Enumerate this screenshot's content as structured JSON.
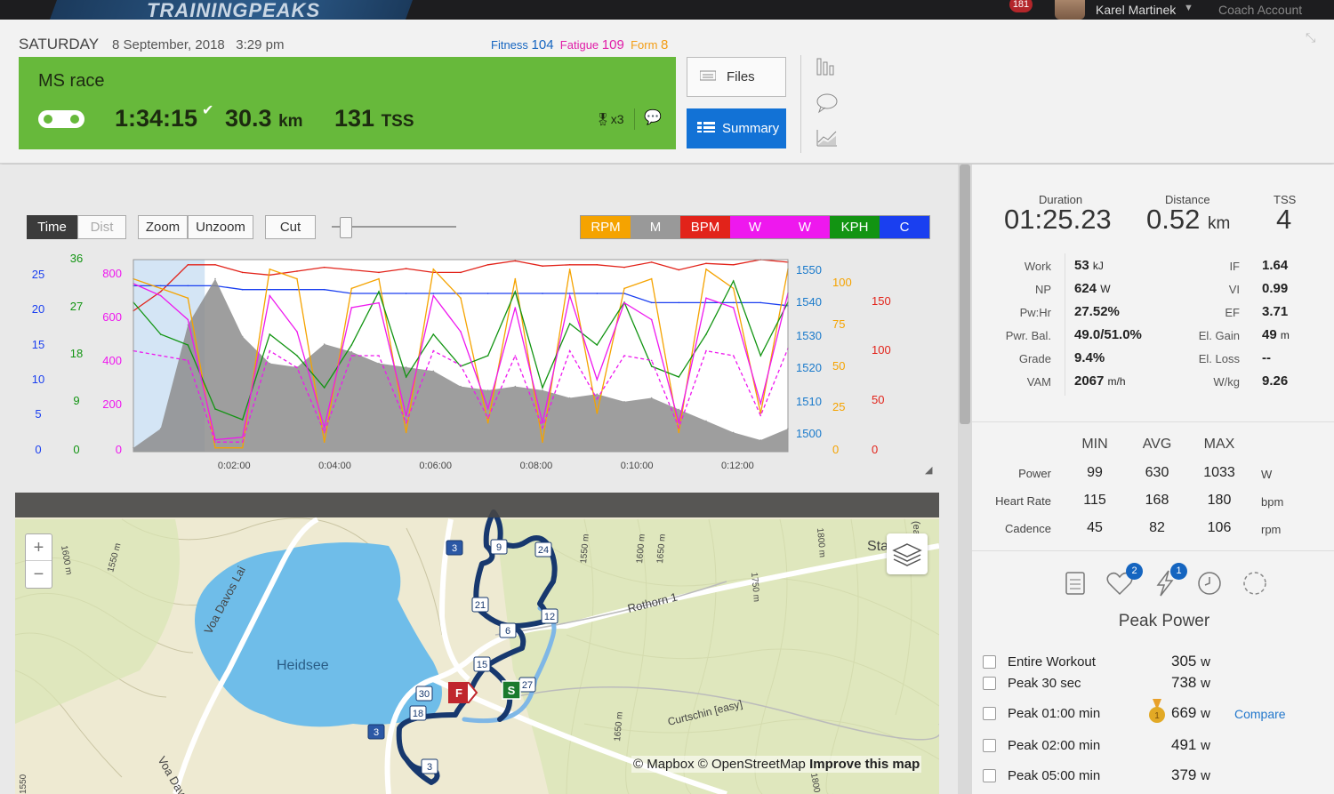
{
  "app": {
    "logo": "TRAININGPEAKS",
    "notifications": "181",
    "user": "Karel Martinek",
    "coach": "Coach Account"
  },
  "header": {
    "day": "SATURDAY",
    "datetime": "8 September, 2018   3:29 pm",
    "fitness_label": "Fitness",
    "fitness": "104",
    "fatigue_label": "Fatigue",
    "fatigue": "109",
    "form_label": "Form",
    "form": "8",
    "fitness_color": "#1565c0",
    "fatigue_color": "#e01ea8",
    "form_color": "#f39c12"
  },
  "workout": {
    "name": "MS race",
    "duration": "1:34:15",
    "distance": "30.3",
    "distance_unit": "km",
    "tss": "131",
    "tss_unit": "TSS",
    "medals": "x3",
    "color": "#67b93b"
  },
  "buttons": {
    "files": "Files",
    "summary": "Summary"
  },
  "toolbar": {
    "time": "Time",
    "dist": "Dist",
    "zoom": "Zoom",
    "unzoom": "Unzoom",
    "cut": "Cut"
  },
  "legend": [
    {
      "label": "RPM",
      "color": "#f5a300"
    },
    {
      "label": "M",
      "color": "#999999"
    },
    {
      "label": "BPM",
      "color": "#e2231a"
    },
    {
      "label": "W",
      "color": "#ee18ee"
    },
    {
      "label": "W",
      "color": "#ee18ee"
    },
    {
      "label": "KPH",
      "color": "#129412"
    },
    {
      "label": "C",
      "color": "#1a3ff0"
    }
  ],
  "chart_data": {
    "type": "line",
    "x_ticks": [
      "0:02:00",
      "0:04:00",
      "0:06:00",
      "0:08:00",
      "0:10:00",
      "0:12:00"
    ],
    "axes": {
      "blue_ticks": [
        "25",
        "20",
        "15",
        "10",
        "5",
        "0"
      ],
      "green_ticks": [
        "36",
        "27",
        "18",
        "9",
        "0"
      ],
      "magenta_ticks": [
        "800",
        "600",
        "400",
        "200",
        "0"
      ],
      "elev_ticks": [
        "1550",
        "1540",
        "1530",
        "1520",
        "1510",
        "1500"
      ],
      "orange_ticks": [
        "100",
        "75",
        "50",
        "25",
        "0"
      ],
      "red_ticks": [
        "150",
        "100",
        "50",
        "0"
      ]
    },
    "ylim": {
      "blue": [
        0,
        25
      ],
      "green": [
        0,
        36
      ],
      "magenta": [
        0,
        800
      ],
      "elevation": [
        1500,
        1550
      ],
      "orange": [
        0,
        100
      ],
      "red": [
        0,
        150
      ]
    },
    "series": [
      {
        "name": "BPM",
        "color": "#e2231a",
        "axis": "red",
        "values": [
          110,
          125,
          146,
          146,
          140,
          138,
          141,
          144,
          142,
          140,
          143,
          140,
          140,
          146,
          149,
          145,
          146,
          146,
          144,
          148,
          142,
          147,
          146,
          150,
          148
        ]
      },
      {
        "name": "C",
        "color": "#1a3ff0",
        "axis": "blue",
        "values": [
          21.6,
          21.6,
          21.6,
          21.6,
          21.1,
          21.1,
          21.1,
          21.1,
          20.6,
          20.6,
          20.6,
          20.6,
          20.6,
          20.6,
          20.6,
          20.6,
          20.6,
          20.6,
          20.6,
          19.4,
          19.4,
          19.4,
          19.4,
          19.4,
          19.0
        ]
      },
      {
        "name": "M",
        "color": "#999999",
        "axis": "elev",
        "values": [
          1501,
          1506,
          1533,
          1545,
          1530,
          1523,
          1522,
          1528,
          1526,
          1523,
          1522,
          1521,
          1517,
          1516,
          1517,
          1516,
          1514,
          1515,
          1513,
          1514,
          1511,
          1508,
          1505,
          1503,
          1506
        ]
      },
      {
        "name": "RPM",
        "color": "#f5a300",
        "axis": "orange",
        "values": [
          90,
          85,
          80,
          2,
          2,
          95,
          90,
          5,
          85,
          90,
          10,
          95,
          80,
          15,
          90,
          5,
          95,
          20,
          85,
          90,
          10,
          95,
          85,
          20,
          95
        ]
      },
      {
        "name": "KPH",
        "color": "#129412",
        "axis": "green",
        "values": [
          28,
          22,
          20,
          8,
          6,
          22,
          18,
          12,
          20,
          30,
          14,
          22,
          16,
          18,
          30,
          12,
          24,
          20,
          28,
          16,
          14,
          22,
          32,
          18,
          28
        ]
      },
      {
        "name": "W",
        "color": "#ee18ee",
        "axis": "magenta",
        "values": [
          700,
          650,
          550,
          50,
          60,
          650,
          500,
          100,
          600,
          620,
          150,
          650,
          500,
          180,
          600,
          120,
          650,
          300,
          620,
          550,
          120,
          640,
          600,
          200,
          660
        ]
      },
      {
        "name": "W",
        "color": "#ee18ee",
        "axis": "magenta",
        "values": [
          420,
          400,
          380,
          40,
          40,
          420,
          350,
          80,
          400,
          400,
          120,
          420,
          360,
          140,
          400,
          100,
          420,
          220,
          400,
          380,
          100,
          420,
          400,
          150,
          430
        ]
      }
    ],
    "selection": {
      "from": "0:00:00",
      "to": "0:01:25"
    }
  },
  "map": {
    "labels": {
      "lake": "Heidsee",
      "road1": "Voa Davos Lai",
      "road2": "Rothorn 1",
      "road3": "Curtschin [easy]",
      "road4": "Voa Davos",
      "road5": "Sta",
      "road6": "(easy)",
      "c1": "1600 m",
      "c2": "1550 m",
      "c3": "1550 m",
      "c4": "1600 m",
      "c5": "1650 m",
      "c6": "1750 m",
      "c7": "1800 m",
      "c8": "1650 m",
      "c9": "1550",
      "c10": "1800 m"
    },
    "markers": [
      "3",
      "9",
      "24",
      "21",
      "12",
      "6",
      "15",
      "27",
      "30",
      "18",
      "3",
      "3"
    ],
    "start": "S",
    "finish": "F",
    "zoom_in": "+",
    "zoom_out": "−",
    "attribution_mapbox": "© Mapbox",
    "attribution_osm": "© OpenStreetMap",
    "improve": "Improve this map"
  },
  "summary": {
    "duration_label": "Duration",
    "duration": "01:25.23",
    "distance_label": "Distance",
    "distance": "0.52",
    "distance_unit": "km",
    "tss_label": "TSS",
    "tss": "4",
    "left_stats": [
      {
        "label": "Work",
        "value": "53",
        "unit": "kJ"
      },
      {
        "label": "NP",
        "value": "624",
        "unit": "W"
      },
      {
        "label": "Pw:Hr",
        "value": "27.52%",
        "unit": ""
      },
      {
        "label": "Pwr. Bal.",
        "value": "49.0/51.0%",
        "unit": ""
      },
      {
        "label": "Grade",
        "value": "9.4%",
        "unit": ""
      },
      {
        "label": "VAM",
        "value": "2067",
        "unit": "m/h"
      }
    ],
    "right_stats": [
      {
        "label": "IF",
        "value": "1.64",
        "unit": ""
      },
      {
        "label": "VI",
        "value": "0.99",
        "unit": ""
      },
      {
        "label": "EF",
        "value": "3.71",
        "unit": ""
      },
      {
        "label": "El. Gain",
        "value": "49",
        "unit": "m"
      },
      {
        "label": "El. Loss",
        "value": "--",
        "unit": ""
      },
      {
        "label": "W/kg",
        "value": "9.26",
        "unit": ""
      }
    ],
    "mma_headers": [
      "MIN",
      "AVG",
      "MAX"
    ],
    "mma_rows": [
      {
        "label": "Power",
        "min": "99",
        "avg": "630",
        "max": "1033",
        "unit": "W"
      },
      {
        "label": "Heart Rate",
        "min": "115",
        "avg": "168",
        "max": "180",
        "unit": "bpm"
      },
      {
        "label": "Cadence",
        "min": "45",
        "avg": "82",
        "max": "106",
        "unit": "rpm"
      }
    ],
    "peak_badges": {
      "heart": "2",
      "power": "1"
    },
    "peak_title": "Peak Power",
    "peaks": [
      {
        "name": "Entire Workout",
        "value": "305",
        "unit": "w"
      },
      {
        "name": "Peak 30 sec",
        "value": "738",
        "unit": "w"
      },
      {
        "name": "Peak 01:00 min",
        "value": "669",
        "unit": "w"
      },
      {
        "name": "Peak 02:00 min",
        "value": "491",
        "unit": "w"
      },
      {
        "name": "Peak 05:00 min",
        "value": "379",
        "unit": "w"
      }
    ],
    "medal_rank": "1",
    "compare": "Compare"
  }
}
